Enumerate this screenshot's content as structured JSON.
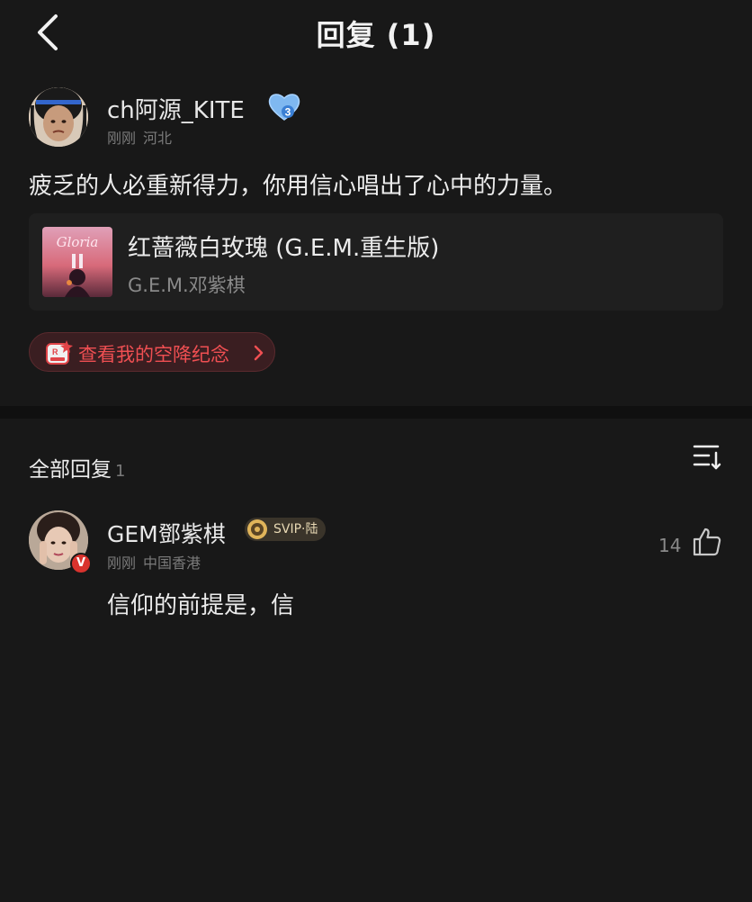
{
  "header": {
    "title": "回复 (1)",
    "back_icon": "chevron-left-icon"
  },
  "post": {
    "author": "ch阿源_KITE",
    "level_badge": "3",
    "time": "刚刚",
    "location": "河北",
    "text": "疲乏的人必重新得力，你用信心唱出了心中的力量。",
    "song": {
      "title": "红蔷薇白玫瑰 (G.E.M.重生版)",
      "artist": "G.E.M.邓紫棋",
      "cover_text": "Gloria"
    },
    "airdrop_label": "查看我的空降纪念"
  },
  "replies": {
    "header": "全部回复",
    "count": "1",
    "items": [
      {
        "author": "GEM鄧紫棋",
        "verified_badge": "V",
        "vip_badge": "SVIP·陆",
        "time": "刚刚",
        "location": "中国香港",
        "likes": "14",
        "text": "信仰的前提是，信"
      }
    ]
  },
  "colors": {
    "background": "#181818",
    "card": "#1f1f1f",
    "accent_red": "#ef4f52",
    "muted_text": "#7a7a7a"
  }
}
